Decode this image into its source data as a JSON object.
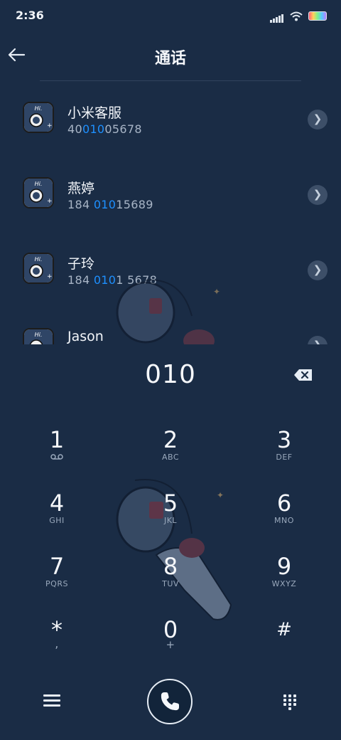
{
  "status": {
    "time": "2:36"
  },
  "header": {
    "title": "通话",
    "back_icon": "arrow-left-icon"
  },
  "contacts": [
    {
      "name": "小米客服",
      "number_pre": "40",
      "number_hl": "010",
      "number_post": "05678"
    },
    {
      "name": "燕婷",
      "number_pre": "184 ",
      "number_hl": "010",
      "number_post": "15689"
    },
    {
      "name": "子玲",
      "number_pre": "184 ",
      "number_hl": "010",
      "number_post": "1 5678"
    },
    {
      "name": "Jason",
      "number_pre": "",
      "number_hl": "",
      "number_post": ""
    }
  ],
  "input": {
    "digits": "010"
  },
  "keypad": [
    {
      "digit": "1",
      "letters": ""
    },
    {
      "digit": "2",
      "letters": "ABC"
    },
    {
      "digit": "3",
      "letters": "DEF"
    },
    {
      "digit": "4",
      "letters": "GHI"
    },
    {
      "digit": "5",
      "letters": "JKL"
    },
    {
      "digit": "6",
      "letters": "MNO"
    },
    {
      "digit": "7",
      "letters": "PQRS"
    },
    {
      "digit": "8",
      "letters": "TUV"
    },
    {
      "digit": "9",
      "letters": "WXYZ"
    },
    {
      "digit": "*",
      "letters": ","
    },
    {
      "digit": "0",
      "letters": "+"
    },
    {
      "digit": "#",
      "letters": ""
    }
  ],
  "colors": {
    "background": "#1a2c45",
    "highlight": "#1e90ff"
  }
}
